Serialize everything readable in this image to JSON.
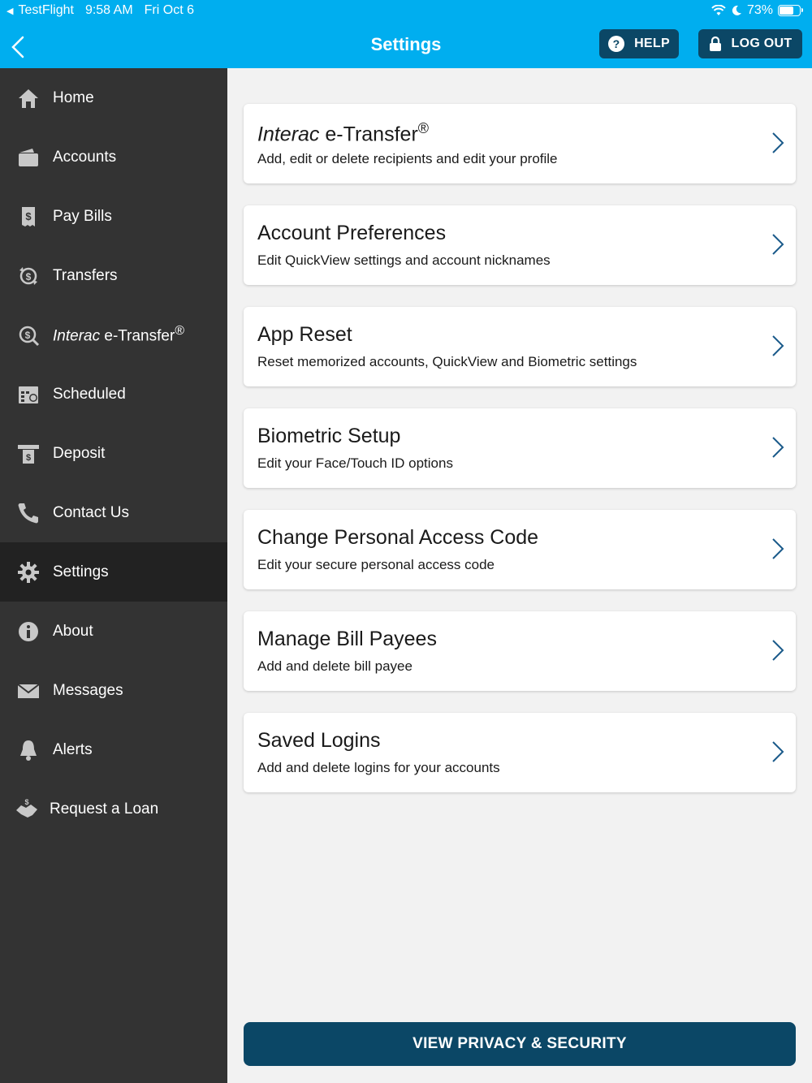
{
  "status_bar": {
    "app": "TestFlight",
    "time": "9:58 AM",
    "date": "Fri Oct 6",
    "battery": "73%",
    "battery_level": 0.73
  },
  "header": {
    "title": "Settings",
    "help_label": "HELP",
    "logout_label": "LOG OUT"
  },
  "sidebar": {
    "items": [
      {
        "label": "Home",
        "icon": "home-icon"
      },
      {
        "label": "Accounts",
        "icon": "wallet-icon"
      },
      {
        "label": "Pay Bills",
        "icon": "bill-icon"
      },
      {
        "label": "Transfers",
        "icon": "transfer-icon"
      },
      {
        "label_italic": "Interac",
        "label": " e-Transfer",
        "suffix": "®",
        "icon": "etransfer-icon"
      },
      {
        "label": "Scheduled",
        "icon": "calendar-icon"
      },
      {
        "label": "Deposit",
        "icon": "deposit-icon"
      },
      {
        "label": "Contact Us",
        "icon": "phone-icon"
      },
      {
        "label": "Settings",
        "icon": "gear-icon",
        "active": true
      },
      {
        "label": "About",
        "icon": "info-icon"
      },
      {
        "label": "Messages",
        "icon": "envelope-icon"
      },
      {
        "label": "Alerts",
        "icon": "bell-icon"
      },
      {
        "label": "Request a Loan",
        "icon": "handshake-icon"
      }
    ]
  },
  "settings": [
    {
      "title_italic": "Interac",
      "title": " e-Transfer",
      "suffix": "®",
      "subtitle": "Add, edit or delete recipients and edit your profile"
    },
    {
      "title": "Account Preferences",
      "subtitle": "Edit QuickView settings and account nicknames"
    },
    {
      "title": "App Reset",
      "subtitle": "Reset memorized accounts, QuickView and Biometric settings"
    },
    {
      "title": "Biometric Setup",
      "subtitle": "Edit your Face/Touch ID options"
    },
    {
      "title": "Change Personal Access Code",
      "subtitle": "Edit your secure personal access code"
    },
    {
      "title": "Manage Bill Payees",
      "subtitle": "Add and delete bill payee"
    },
    {
      "title": "Saved Logins",
      "subtitle": "Add and delete logins for your accounts"
    }
  ],
  "privacy_button": "VIEW PRIVACY & SECURITY",
  "colors": {
    "header": "#00aeef",
    "sidebar": "#333333",
    "sidebar_active": "#222222",
    "primary_button": "#0b4766",
    "chevron": "#1a5a8a"
  }
}
